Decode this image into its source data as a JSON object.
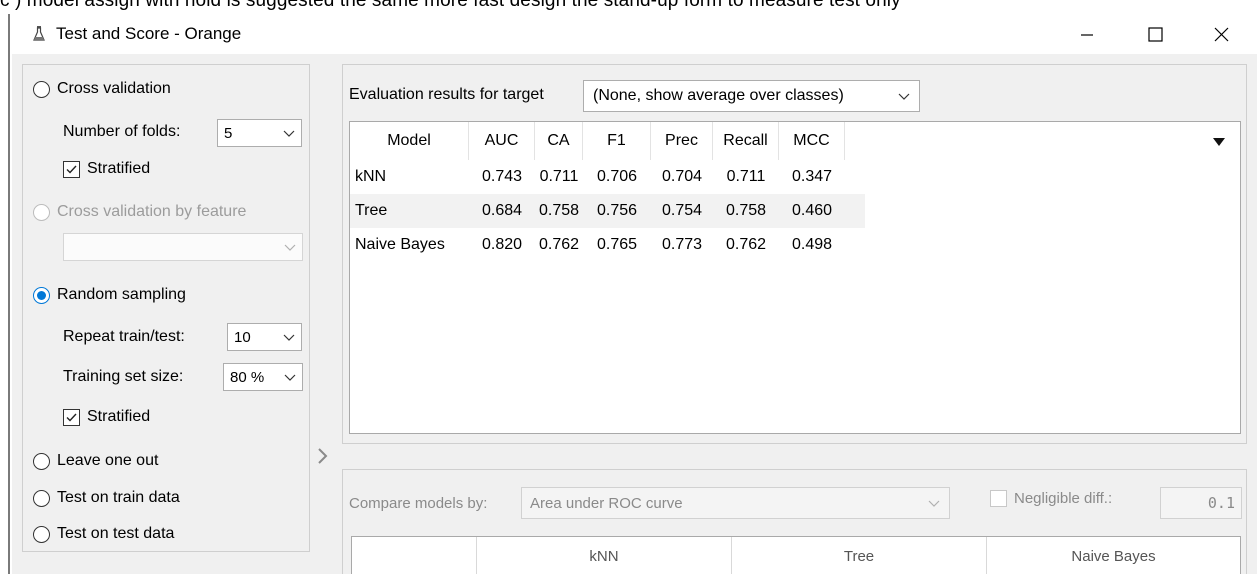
{
  "top_strip_text": "c  )  model  assign  with  hold  is  suggested  the  same  more  fast  design  the  stand-up  form  to  measure  test  only",
  "window": {
    "title": "Test and Score - Orange",
    "min_glyph": "—",
    "max_glyph": "☐",
    "close_glyph": "✕"
  },
  "sampling": {
    "cross_validation": "Cross validation",
    "number_of_folds_label": "Number of folds:",
    "number_of_folds_value": "5",
    "stratified_1": "Stratified",
    "cross_validation_by_feature": "Cross validation by feature",
    "feature_value": "",
    "random_sampling": "Random sampling",
    "repeat_label": "Repeat train/test:",
    "repeat_value": "10",
    "training_size_label": "Training set size:",
    "training_size_value": "80 %",
    "stratified_2": "Stratified",
    "leave_one_out": "Leave one out",
    "test_on_train": "Test on train data",
    "test_on_test": "Test on test data",
    "selected": "Random sampling"
  },
  "evaluation": {
    "target_label": "Evaluation results for target",
    "target_value": "(None, show average over classes)",
    "columns": [
      "Model",
      "AUC",
      "CA",
      "F1",
      "Prec",
      "Recall",
      "MCC"
    ],
    "rows": [
      [
        "kNN",
        "0.743",
        "0.711",
        "0.706",
        "0.704",
        "0.711",
        "0.347"
      ],
      [
        "Tree",
        "0.684",
        "0.758",
        "0.756",
        "0.754",
        "0.758",
        "0.460"
      ],
      [
        "Naive Bayes",
        "0.820",
        "0.762",
        "0.765",
        "0.773",
        "0.762",
        "0.498"
      ]
    ]
  },
  "compare": {
    "label": "Compare models by:",
    "value": "Area under ROC curve",
    "negligible_label": "Negligible diff.:",
    "negligible_value": "0.1",
    "columns": [
      "",
      "kNN",
      "Tree",
      "Naive Bayes"
    ]
  },
  "colors": {
    "accent": "#0078d7",
    "panel_bg": "#f0f0f0",
    "alt_row": "#f2f2f2"
  },
  "icons": {
    "app": "orange-flask-icon",
    "dropdown": "chevron-down-icon",
    "splitter": "chevron-right-icon",
    "column_menu": "triangle-down-icon"
  }
}
